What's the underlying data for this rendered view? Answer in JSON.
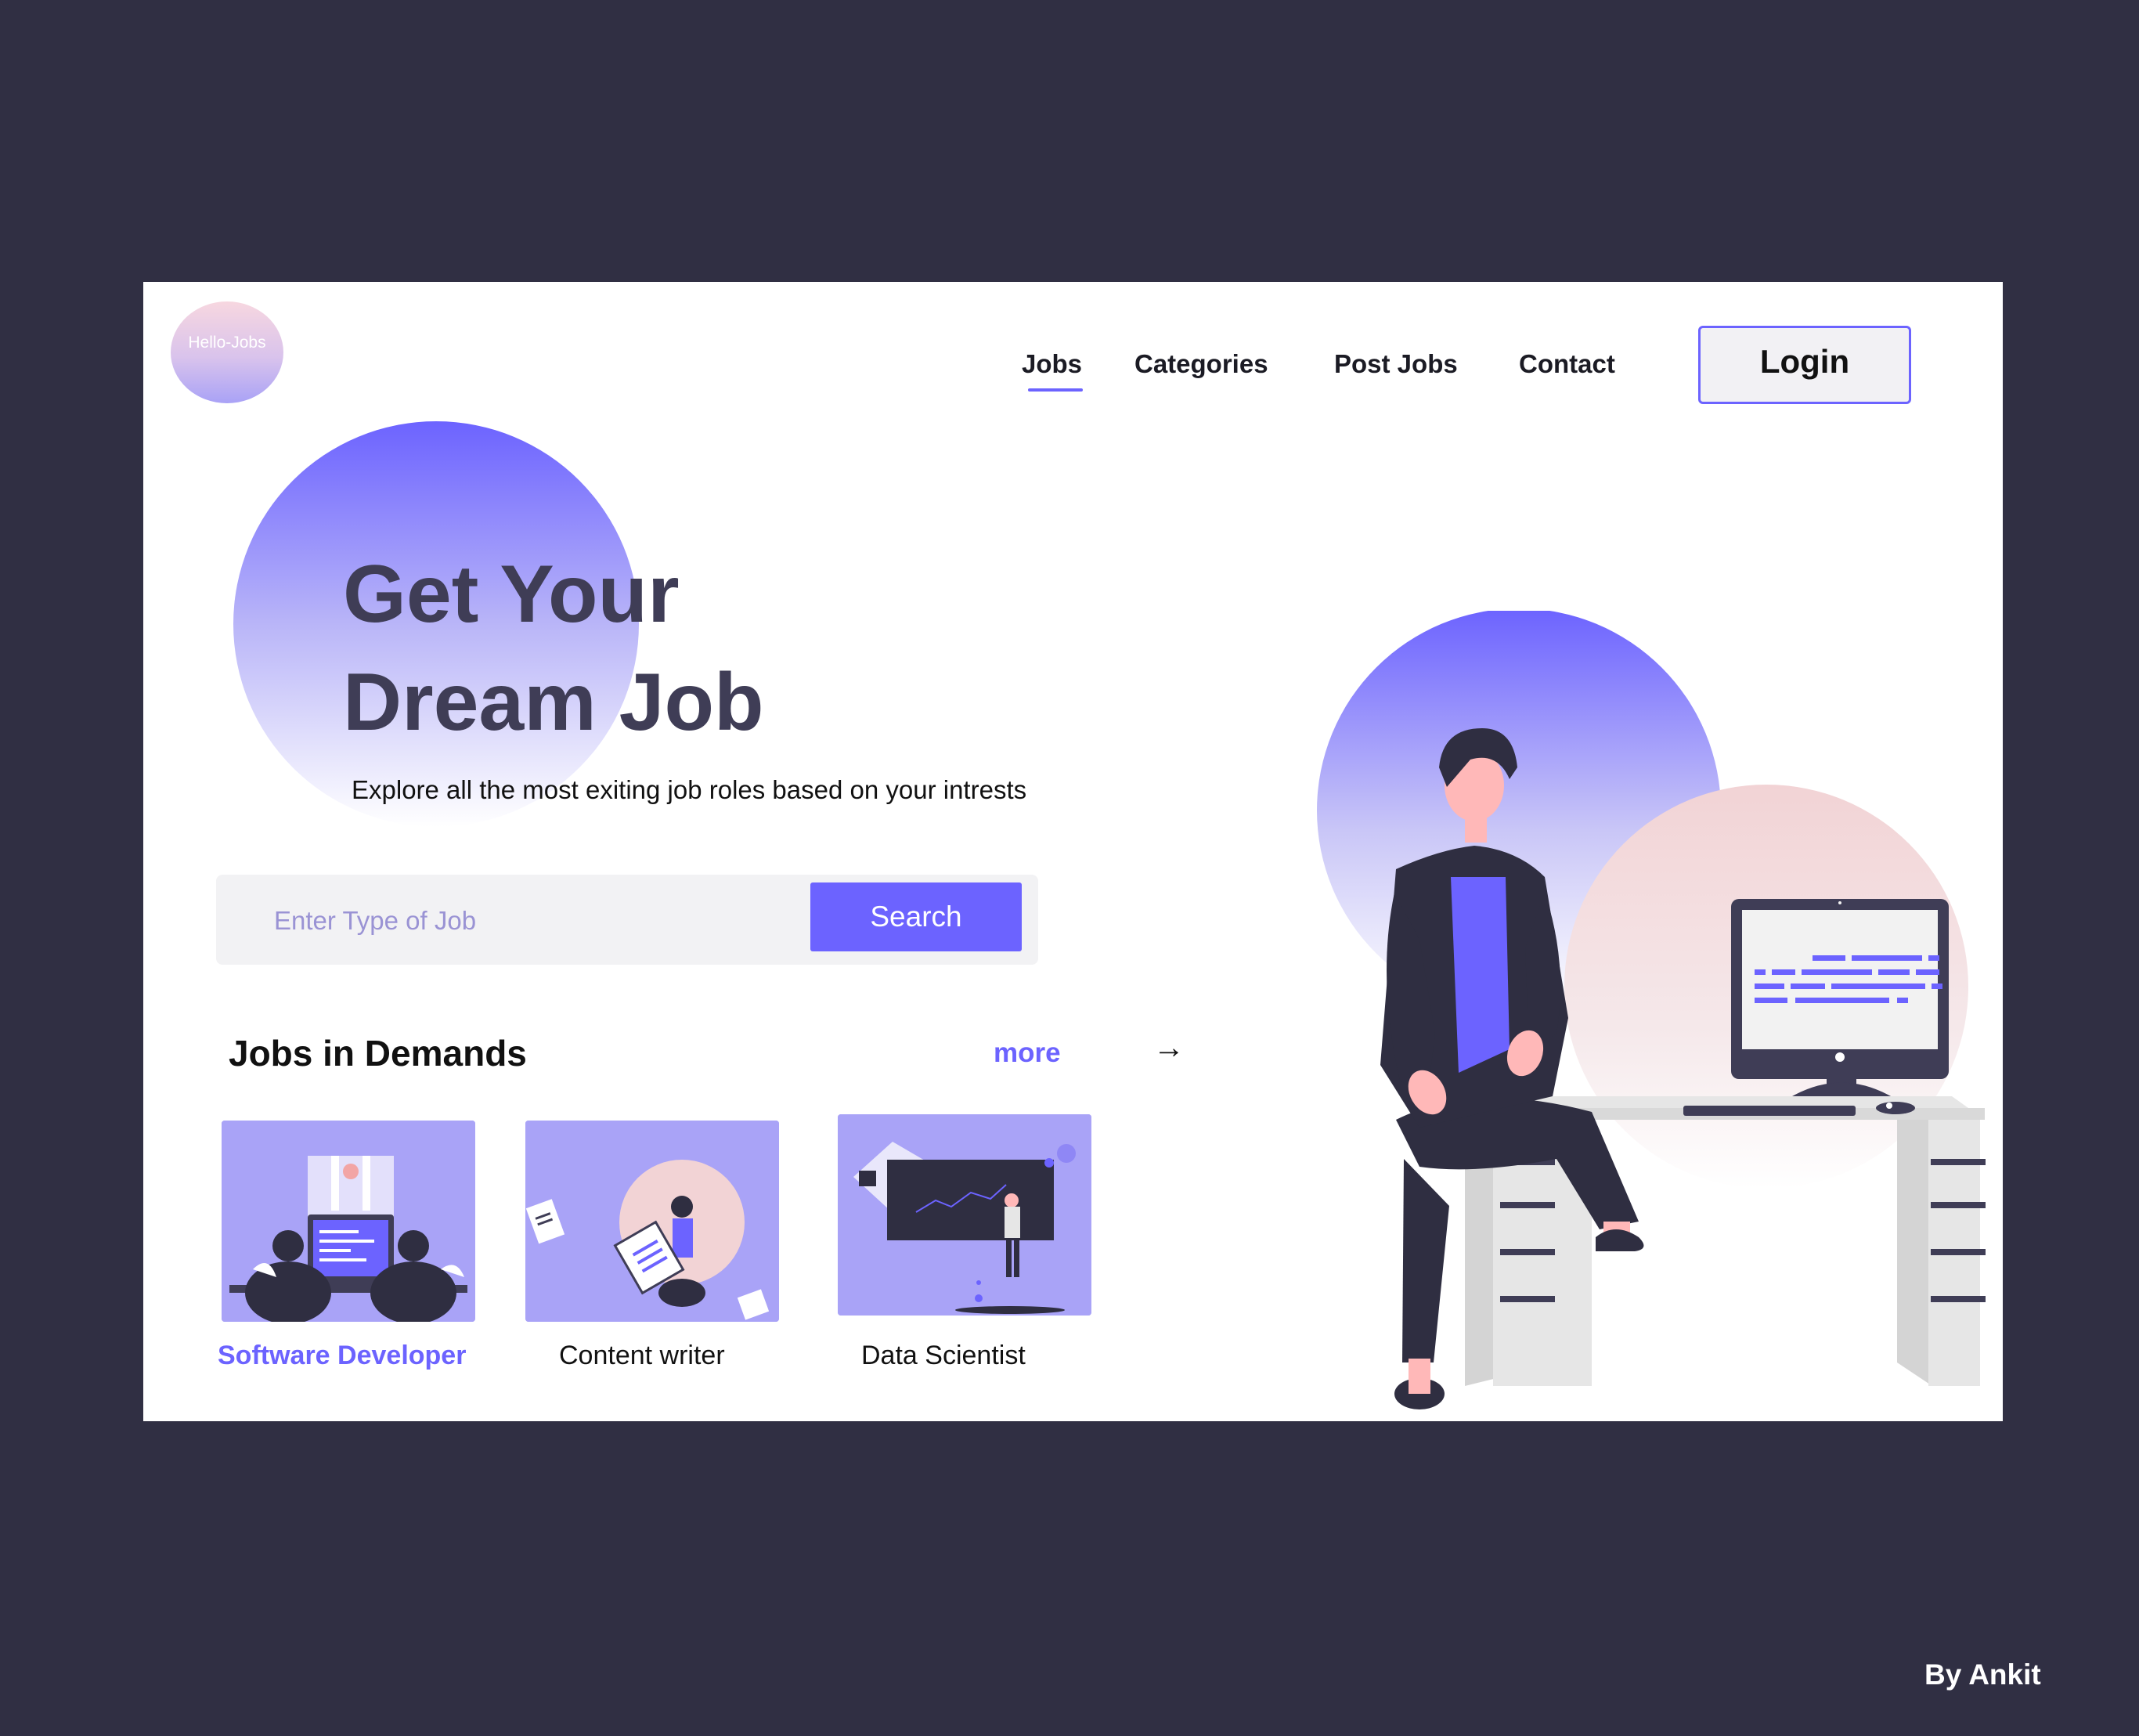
{
  "logo": {
    "text": "Hello-Jobs"
  },
  "nav": {
    "items": [
      "Jobs",
      "Categories",
      "Post Jobs",
      "Contact"
    ],
    "active": "Jobs",
    "login_label": "Login"
  },
  "hero": {
    "title_line1": "Get Your",
    "title_line2": "Dream Job",
    "subtitle": "Explore all the most exiting job roles based on your intrests"
  },
  "search": {
    "placeholder": "Enter Type of Job",
    "value": "",
    "button_label": "Search"
  },
  "jobs_section": {
    "title": "Jobs in Demands",
    "more_label": "more",
    "arrow": "→",
    "cards": [
      {
        "label": "Software Developer",
        "highlighted": true
      },
      {
        "label": "Content writer",
        "highlighted": false
      },
      {
        "label": "Data Scientist",
        "highlighted": false
      }
    ]
  },
  "credit": "By Ankit",
  "colors": {
    "accent": "#6c63ff",
    "dark": "#3f3d56",
    "background": "#302f43",
    "card": "#ffffff",
    "pink": "#f2d3d5"
  }
}
